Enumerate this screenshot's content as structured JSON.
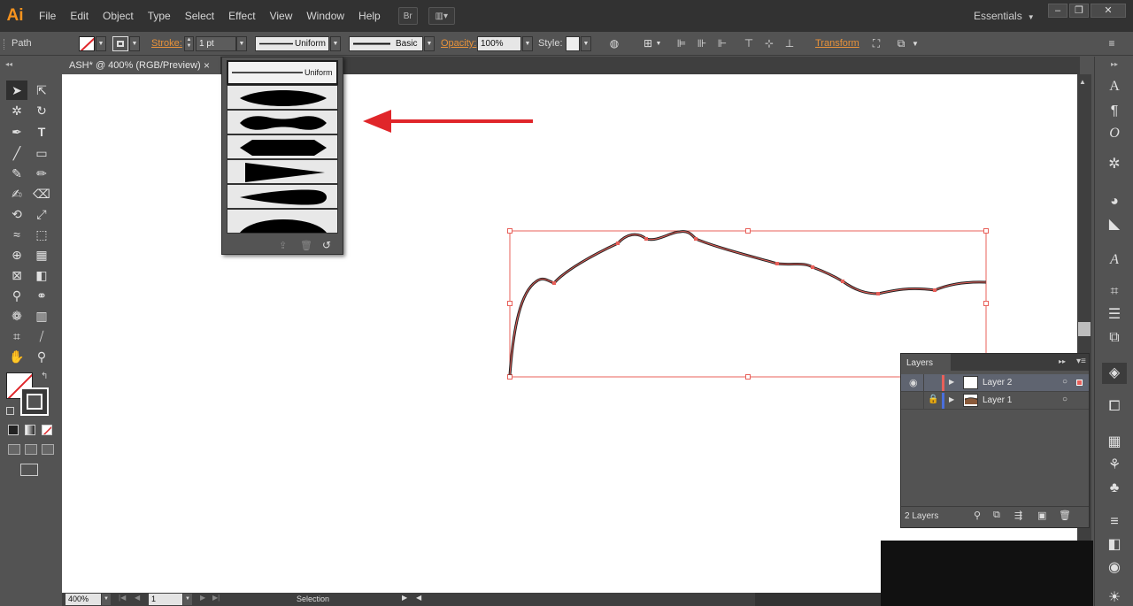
{
  "app": {
    "logo": "Ai",
    "document_tab": "ASH* @ 400% (RGB/Preview)",
    "tab_close": "×",
    "workspace": "Essentials"
  },
  "menu": [
    "File",
    "Edit",
    "Object",
    "Type",
    "Select",
    "Effect",
    "View",
    "Window",
    "Help"
  ],
  "menubar_buttons": {
    "bridge": "Br",
    "arrange": "▥▾"
  },
  "window_buttons": {
    "minimize": "–",
    "restore": "❐",
    "close": "✕"
  },
  "control_bar": {
    "selection_type": "Path",
    "stroke_label": "Stroke:",
    "stroke_weight": "1 pt",
    "variable_width_profile": "Uniform",
    "brush_definition": "Basic",
    "opacity_label": "Opacity:",
    "opacity_value": "100%",
    "style_label": "Style:",
    "transform_label": "Transform"
  },
  "width_profile_popup": {
    "selected": "Uniform",
    "profiles": [
      "Width Profile 1",
      "Width Profile 2",
      "Width Profile 3",
      "Width Profile 4",
      "Width Profile 5",
      "Width Profile 6"
    ]
  },
  "layers_panel": {
    "title": "Layers",
    "layers": [
      {
        "name": "Layer 2",
        "color": "#e8605a",
        "selected": true
      },
      {
        "name": "Layer 1",
        "color": "#4a6fdc",
        "locked": true
      }
    ],
    "count_label": "2 Layers"
  },
  "status_bar": {
    "zoom": "400%",
    "artboard": "1",
    "current_tool": "Selection"
  },
  "colors": {
    "accent_orange": "#e8923a",
    "selection_red": "#e8605a",
    "arrow_red": "#e0262a",
    "canvas": "#ffffff",
    "ui_dark": "#323232",
    "ui_mid": "#535353"
  }
}
